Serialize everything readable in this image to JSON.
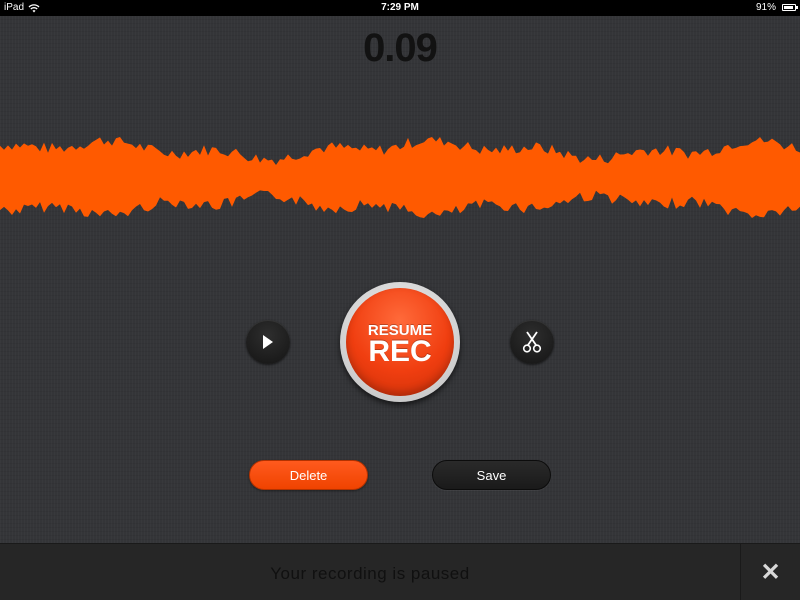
{
  "status_bar": {
    "device": "iPad",
    "time": "7:29 PM",
    "battery": "91%",
    "icons": [
      "wifi-icon",
      "battery-icon"
    ]
  },
  "timer": "0.09",
  "waveform": {
    "color": "#ff5a00",
    "label": "recording-waveform"
  },
  "controls": {
    "play_icon": "play-icon",
    "rec_top": "RESUME",
    "rec_main": "REC",
    "scissors_icon": "scissors-icon"
  },
  "actions": {
    "delete_label": "Delete",
    "save_label": "Save"
  },
  "banner": {
    "message": "Your recording is paused",
    "close_glyph": "✕"
  },
  "colors": {
    "accent": "#f04300",
    "background": "#343538",
    "banner": "#262626"
  }
}
